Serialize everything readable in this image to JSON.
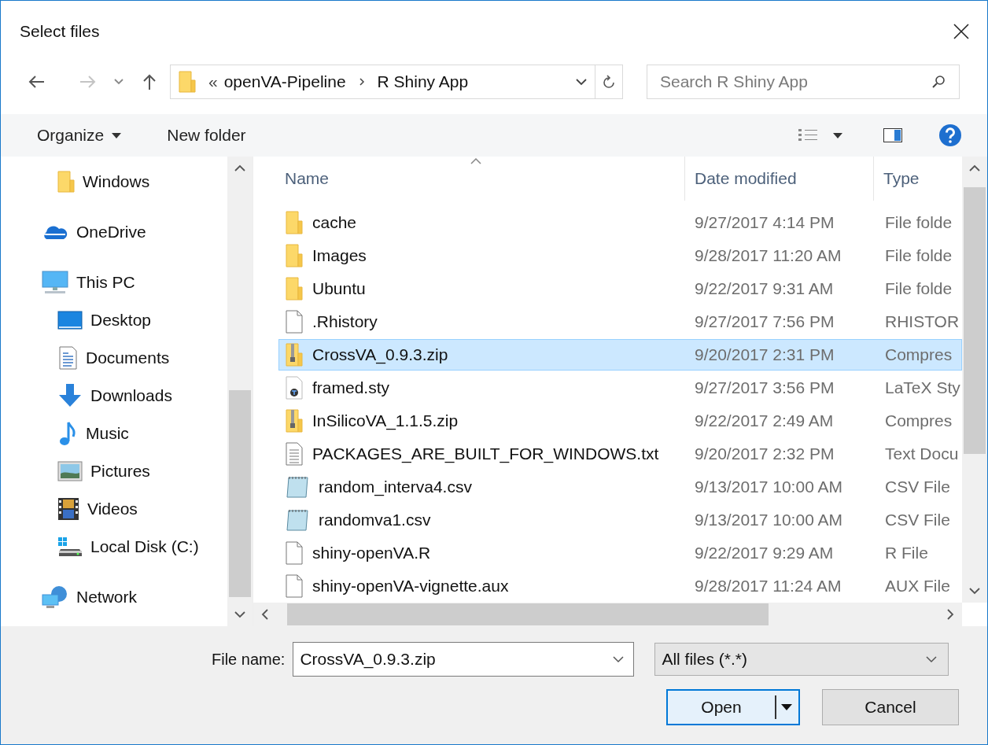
{
  "window": {
    "title": "Select files"
  },
  "address": {
    "overflow": "«",
    "crumbs": [
      "openVA-Pipeline",
      "R Shiny App"
    ]
  },
  "search": {
    "placeholder": "Search R Shiny App"
  },
  "toolbar": {
    "organize": "Organize",
    "new_folder": "New folder"
  },
  "sidebar": {
    "items": [
      {
        "label": "Windows",
        "kind": "folder"
      },
      {
        "label": "OneDrive",
        "kind": "cloud"
      },
      {
        "label": "This PC",
        "kind": "pc",
        "children": [
          {
            "label": "Desktop",
            "kind": "desktop"
          },
          {
            "label": "Documents",
            "kind": "documents"
          },
          {
            "label": "Downloads",
            "kind": "downloads"
          },
          {
            "label": "Music",
            "kind": "music"
          },
          {
            "label": "Pictures",
            "kind": "pictures"
          },
          {
            "label": "Videos",
            "kind": "videos"
          },
          {
            "label": "Local Disk (C:)",
            "kind": "disk"
          }
        ]
      },
      {
        "label": "Network",
        "kind": "network"
      }
    ]
  },
  "table": {
    "columns": [
      {
        "label": "Name",
        "sorted": true
      },
      {
        "label": "Date modified",
        "sorted": false
      },
      {
        "label": "Type",
        "sorted": false
      }
    ],
    "rows": [
      {
        "name": "cache",
        "date": "9/27/2017 4:14 PM",
        "type": "File folde",
        "kind": "folder",
        "selected": false
      },
      {
        "name": "Images",
        "date": "9/28/2017 11:20 AM",
        "type": "File folde",
        "kind": "folder",
        "selected": false
      },
      {
        "name": "Ubuntu",
        "date": "9/22/2017 9:31 AM",
        "type": "File folde",
        "kind": "folder",
        "selected": false
      },
      {
        "name": ".Rhistory",
        "date": "9/27/2017 7:56 PM",
        "type": "RHISTOR",
        "kind": "file",
        "selected": false
      },
      {
        "name": "CrossVA_0.9.3.zip",
        "date": "9/20/2017 2:31 PM",
        "type": "Compres",
        "kind": "zip",
        "selected": true
      },
      {
        "name": "framed.sty",
        "date": "9/27/2017 3:56 PM",
        "type": "LaTeX Sty",
        "kind": "tex",
        "selected": false
      },
      {
        "name": "InSilicoVA_1.1.5.zip",
        "date": "9/22/2017 2:49 AM",
        "type": "Compres",
        "kind": "zip",
        "selected": false
      },
      {
        "name": "PACKAGES_ARE_BUILT_FOR_WINDOWS.txt",
        "date": "9/20/2017 2:32 PM",
        "type": "Text Docu",
        "kind": "text",
        "selected": false
      },
      {
        "name": "random_interva4.csv",
        "date": "9/13/2017 10:00 AM",
        "type": "CSV File",
        "kind": "csv",
        "selected": false
      },
      {
        "name": "randomva1.csv",
        "date": "9/13/2017 10:00 AM",
        "type": "CSV File",
        "kind": "csv",
        "selected": false
      },
      {
        "name": "shiny-openVA.R",
        "date": "9/22/2017 9:29 AM",
        "type": "R File",
        "kind": "file",
        "selected": false
      },
      {
        "name": "shiny-openVA-vignette.aux",
        "date": "9/28/2017 11:24 AM",
        "type": "AUX File",
        "kind": "file",
        "selected": false
      }
    ]
  },
  "footer": {
    "file_name_label": "File name:",
    "file_name": "CrossVA_0.9.3.zip",
    "filter": "All files (*.*)",
    "open": "Open",
    "cancel": "Cancel"
  }
}
